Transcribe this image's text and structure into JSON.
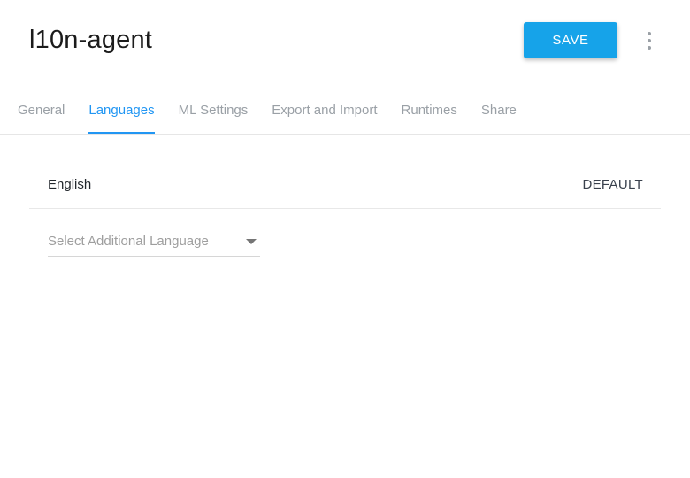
{
  "header": {
    "title": "l10n-agent",
    "save_label": "SAVE",
    "more_options_icon": "kebab-menu-icon"
  },
  "tabs": [
    {
      "label": "General",
      "active": false
    },
    {
      "label": "Languages",
      "active": true
    },
    {
      "label": "ML Settings",
      "active": false
    },
    {
      "label": "Export and Import",
      "active": false
    },
    {
      "label": "Runtimes",
      "active": false
    },
    {
      "label": "Share",
      "active": false
    }
  ],
  "languages": {
    "default_language": "English",
    "default_badge": "DEFAULT",
    "select_placeholder": "Select Additional Language",
    "select_arrow_icon": "dropdown-arrow-icon"
  },
  "colors": {
    "accent_blue": "#2196f3",
    "save_button_blue": "#16a3e9",
    "inactive_tab_gray": "#9aa0a6"
  }
}
